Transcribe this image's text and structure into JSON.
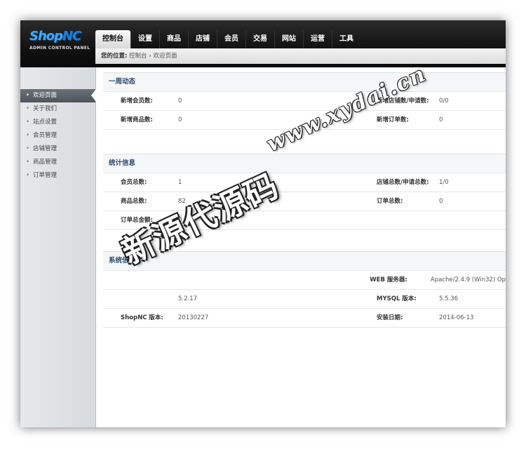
{
  "logo": {
    "brand_a": "Shop",
    "brand_b": "NC",
    "subtitle": "ADMIN CONTROL PANEL"
  },
  "nav": [
    "控制台",
    "设置",
    "商品",
    "店铺",
    "会员",
    "交易",
    "网站",
    "运营",
    "工具"
  ],
  "breadcrumb": {
    "label": "您的位置:",
    "path1": "控制台",
    "sep": "›",
    "path2": "欢迎页面"
  },
  "sidebar": [
    "欢迎页面",
    "关于我们",
    "站点设置",
    "会员管理",
    "店铺管理",
    "商品管理",
    "订单管理"
  ],
  "sections": {
    "weekly": {
      "title": "一周动态",
      "rows": [
        {
          "k1": "新增会员数:",
          "v1": "0",
          "k2": "新增店铺数/申请数:",
          "v2": "0/0"
        },
        {
          "k1": "新增商品数:",
          "v1": "0",
          "k2": "新增订单数:",
          "v2": "0"
        }
      ]
    },
    "stats": {
      "title": "统计信息",
      "rows": [
        {
          "k1": "会员总数:",
          "v1": "1",
          "k2": "店铺总数/申请总数:",
          "v2": "1/0"
        },
        {
          "k1": "商品总数:",
          "v1": "82",
          "k2": "订单总数:",
          "v2": "0"
        },
        {
          "k1": "订单总金额:",
          "v1": "0",
          "k2": "",
          "v2": ""
        }
      ]
    },
    "system": {
      "title": "系统信息",
      "rows": [
        {
          "k1": "",
          "v1": "",
          "k2": "WEB 服务器:",
          "v2": "Apache/2.4.9 (Win32) Op"
        },
        {
          "k1": "",
          "v1": "5.2.17",
          "k2": "MYSQL 版本:",
          "v2": "5.5.36"
        },
        {
          "k1": "ShopNC 版本:",
          "v1": "20130227",
          "k2": "安装日期:",
          "v2": "2014-06-13"
        }
      ]
    }
  },
  "watermark": {
    "url": "www.xydai.cn",
    "text": "新源代源码"
  }
}
